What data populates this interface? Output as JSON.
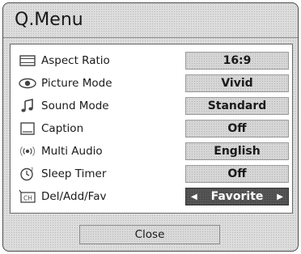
{
  "menu": {
    "title": "Q.Menu",
    "items": [
      {
        "icon": "aspect-ratio-icon",
        "label": "Aspect Ratio",
        "value": "16:9"
      },
      {
        "icon": "picture-mode-icon",
        "label": "Picture Mode",
        "value": "Vivid"
      },
      {
        "icon": "music-note-icon",
        "label": "Sound Mode",
        "value": "Standard"
      },
      {
        "icon": "caption-icon",
        "label": "Caption",
        "value": "Off"
      },
      {
        "icon": "multi-audio-icon",
        "label": "Multi Audio",
        "value": "English"
      },
      {
        "icon": "sleep-timer-icon",
        "label": "Sleep Timer",
        "value": "Off"
      },
      {
        "icon": "channel-icon",
        "label": "Del/Add/Fav",
        "value": "Favorite",
        "icon_text": "CH"
      }
    ],
    "close_label": "Close"
  }
}
